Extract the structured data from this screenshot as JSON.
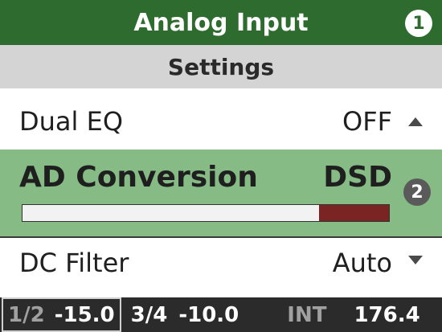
{
  "header": {
    "title": "Analog Input",
    "badge": "1"
  },
  "subheader": {
    "title": "Settings"
  },
  "rows": [
    {
      "label": "Dual EQ",
      "value": "OFF",
      "arrow": "up-arrow-icon"
    },
    {
      "label": "AD Conversion",
      "value": "DSD",
      "badge": "2",
      "meter_level": 0.19
    },
    {
      "label": "DC Filter",
      "value": "Auto",
      "arrow": "down-arrow-icon"
    }
  ],
  "status": {
    "ch1": "1/2",
    "val1": "-15.0",
    "ch2": "3/4",
    "val2": "-10.0",
    "clock": "INT",
    "rate": "176.4"
  },
  "colors": {
    "header_bg": "#2e6b2e",
    "selected_row_bg": "#86bb86",
    "meter_fill": "#7a2424",
    "status_bg": "#2b2b2b"
  }
}
